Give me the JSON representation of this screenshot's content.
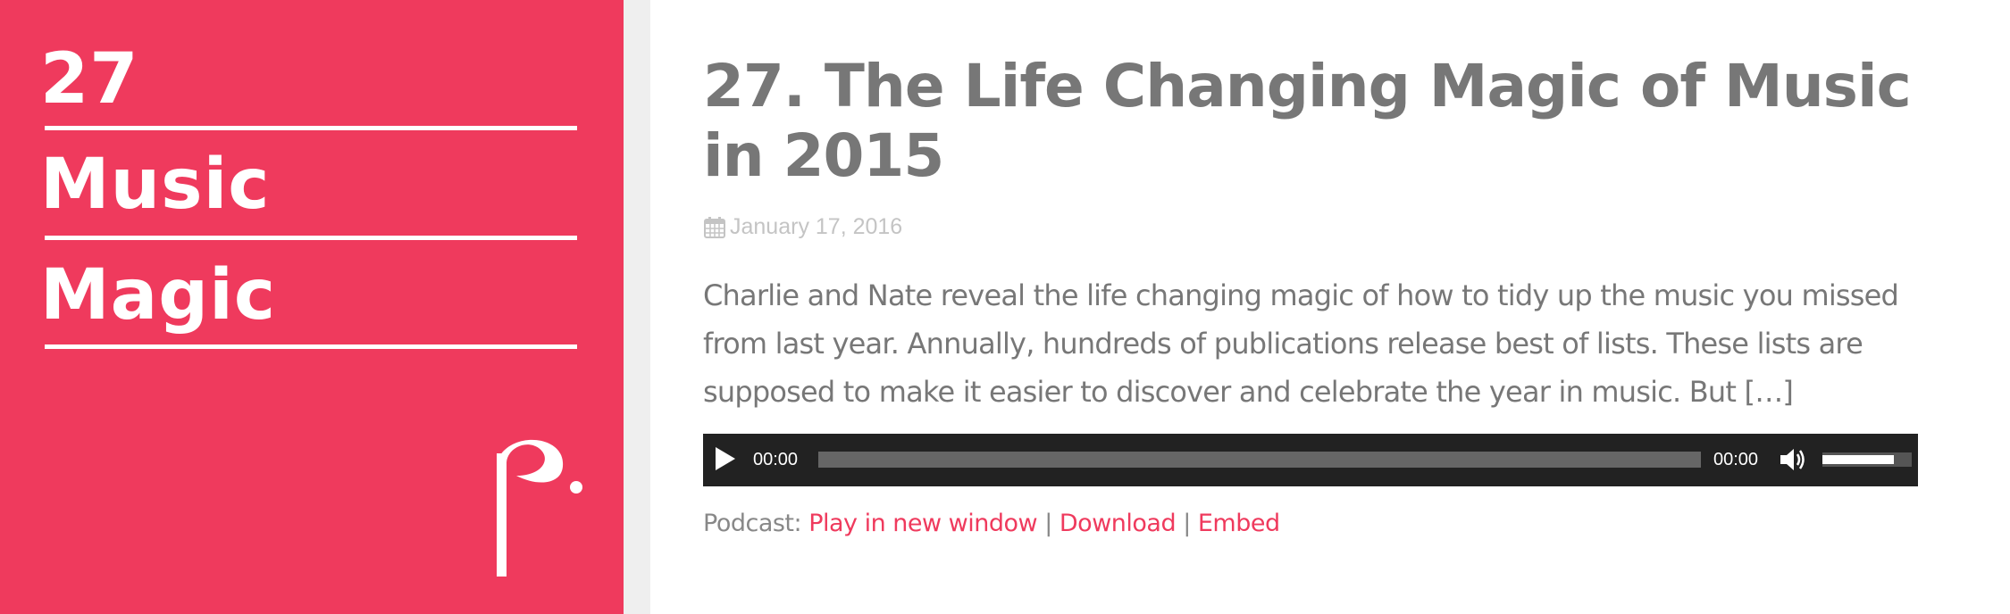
{
  "cover": {
    "number": "27",
    "word1": "Music",
    "word2": "Magic",
    "logo_icon": "music-note-logo-icon",
    "background_color": "#ef3a5d"
  },
  "post": {
    "title": "27. The Life Changing Magic of Music in 2015",
    "date": "January 17, 2016",
    "date_icon": "calendar-icon",
    "excerpt": "Charlie and Nate reveal the life changing magic of how to tidy up the music you missed from last year. Annually, hundreds of publications release best of lists. These lists are supposed to make it easier to discover and celebrate the year in music. But […]"
  },
  "player": {
    "current_time": "00:00",
    "duration": "00:00",
    "play_icon": "play-icon",
    "volume_icon": "volume-icon",
    "progress": 0,
    "volume_level": 0.8
  },
  "podcast": {
    "label": "Podcast: ",
    "play_new_window": "Play in new window",
    "separator": " | ",
    "download": "Download",
    "embed": "Embed",
    "link_color": "#ef3a5d"
  }
}
